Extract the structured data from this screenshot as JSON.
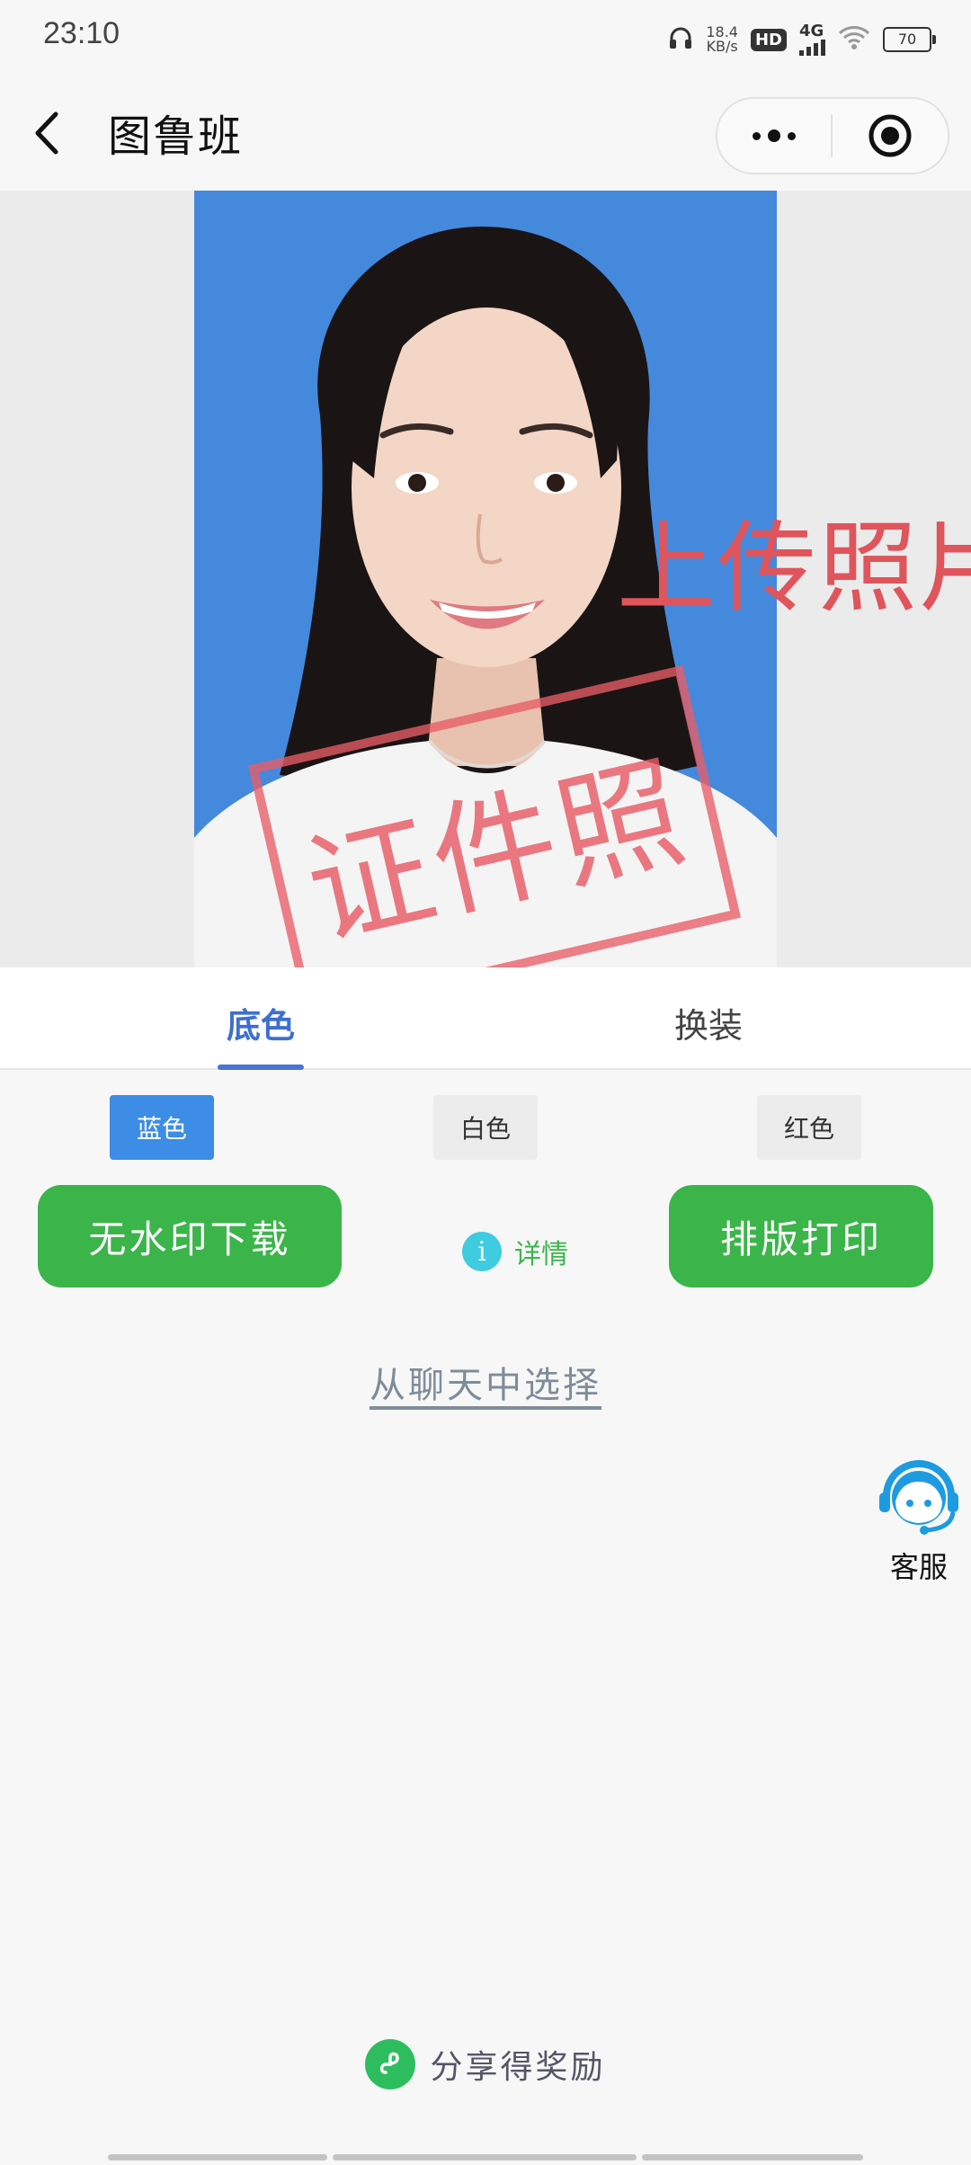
{
  "status_bar": {
    "time": "23:10",
    "net_speed_value": "18.4",
    "net_speed_unit": "KB/s",
    "hd": "HD",
    "network": "4G",
    "battery": "70"
  },
  "nav": {
    "title": "图鲁班"
  },
  "photo": {
    "upload_text": "上传照片",
    "watermark": "证件照",
    "background_color": "#4589dc"
  },
  "tabs": [
    {
      "label": "底色",
      "active": true
    },
    {
      "label": "换装",
      "active": false
    }
  ],
  "colors": [
    {
      "label": "蓝色",
      "selected": true
    },
    {
      "label": "白色",
      "selected": false
    },
    {
      "label": "红色",
      "selected": false
    }
  ],
  "actions": {
    "download": "无水印下载",
    "detail": "详情",
    "print": "排版打印"
  },
  "chat_select": "从聊天中选择",
  "customer_service": "客服",
  "share": "分享得奖励",
  "theme": {
    "green": "#3bb54a",
    "blue": "#3d8ce6",
    "accent_text": "#3d6fd0",
    "watermark_red": "#e0545c"
  }
}
